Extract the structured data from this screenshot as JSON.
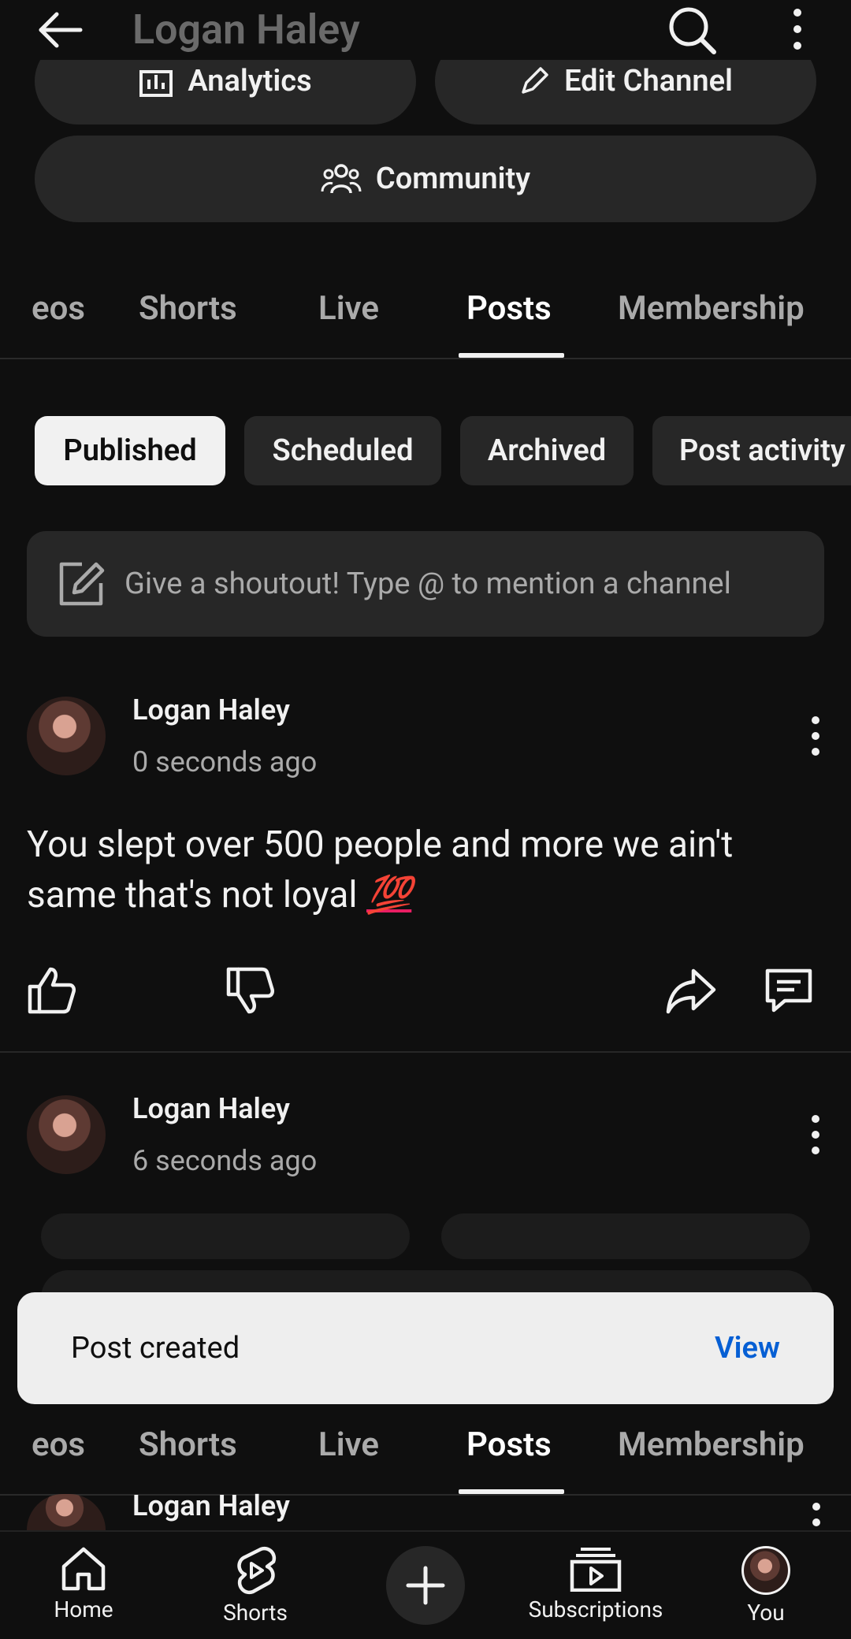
{
  "header": {
    "title": "Logan Haley",
    "icons": [
      "back-arrow-icon",
      "search-icon",
      "more-vert-icon"
    ]
  },
  "channel_actions": {
    "analytics_label": "Analytics",
    "edit_label": "Edit Channel",
    "community_label": "Community"
  },
  "tabs": [
    {
      "label": "eos"
    },
    {
      "label": "Shorts"
    },
    {
      "label": "Live"
    },
    {
      "label": "Posts",
      "active": true
    },
    {
      "label": "Membership"
    }
  ],
  "chips": [
    {
      "label": "Published",
      "active": true
    },
    {
      "label": "Scheduled"
    },
    {
      "label": "Archived"
    },
    {
      "label": "Post activity"
    }
  ],
  "shoutout": {
    "placeholder": "Give a shoutout! Type @ to mention a channel"
  },
  "posts": [
    {
      "author": "Logan Haley",
      "time": "0 seconds ago",
      "text": "You slept over 500 people and more we ain't same that's not loyal",
      "emoji": "💯"
    },
    {
      "author": "Logan Haley",
      "time": "6 seconds ago"
    }
  ],
  "toast": {
    "message": "Post created",
    "action": "View"
  },
  "peek": {
    "author": "Logan Haley"
  },
  "bottom_nav": [
    {
      "label": "Home",
      "icon": "home-icon"
    },
    {
      "label": "Shorts",
      "icon": "shorts-icon"
    },
    {
      "label": "",
      "icon": "create-plus-icon"
    },
    {
      "label": "Subscriptions",
      "icon": "subscriptions-icon"
    },
    {
      "label": "You",
      "icon": "avatar"
    }
  ],
  "colors": {
    "background": "#0f0f0f",
    "surface": "#272727",
    "link": "#065fd4",
    "emoji": "#e91e63"
  }
}
